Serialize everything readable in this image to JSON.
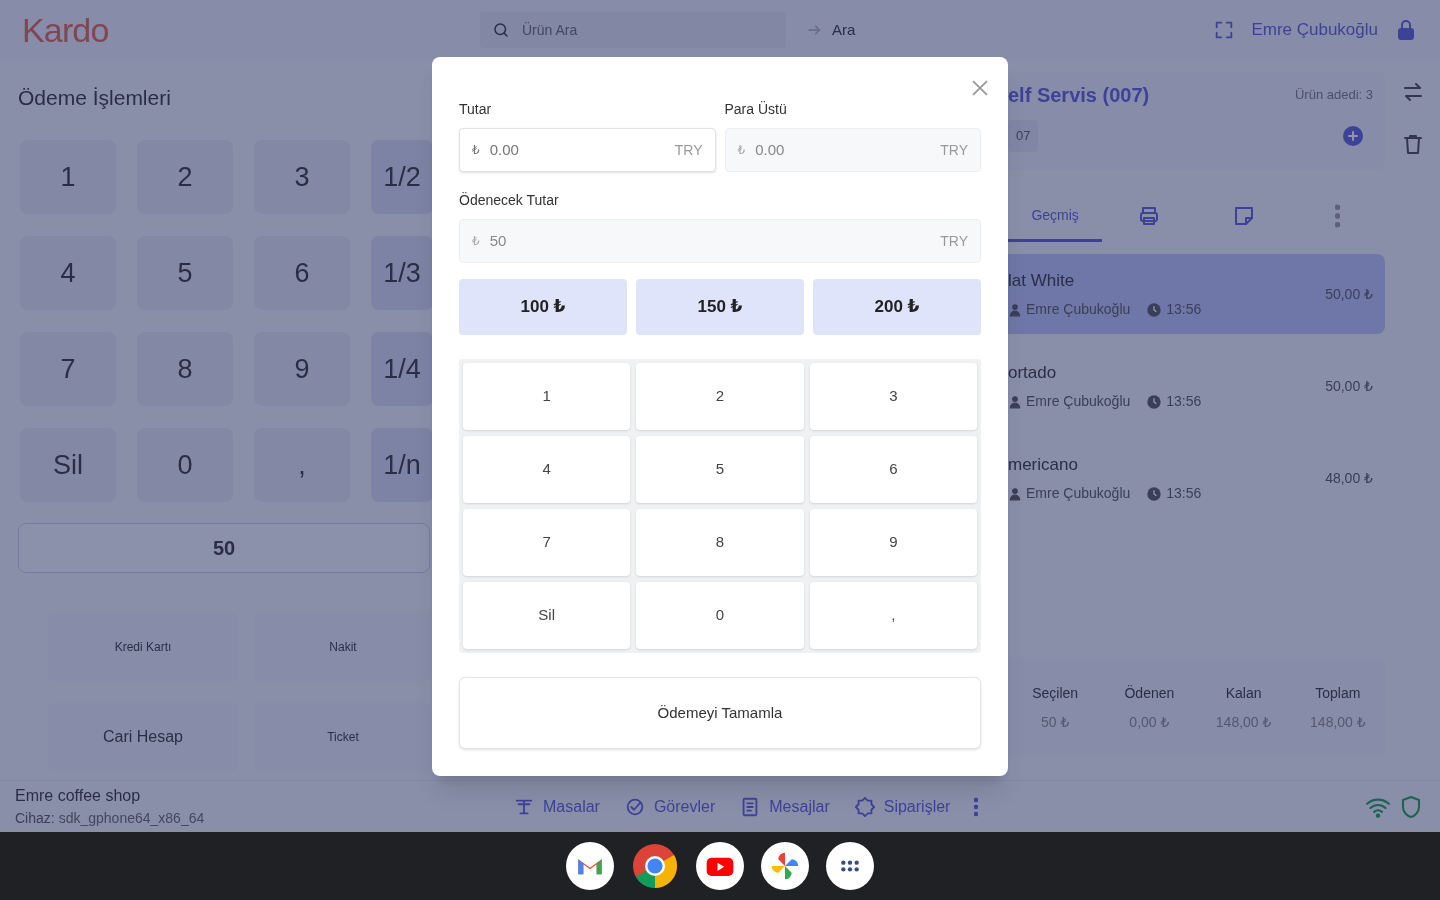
{
  "header": {
    "logo": "Kardo",
    "search_placeholder": "Ürün Ara",
    "search_button": "Ara",
    "user": "Emre Çubukoğlu"
  },
  "payment_panel": {
    "title": "Ödeme İşlemleri",
    "keys": [
      "1",
      "2",
      "3",
      "1/2",
      "4",
      "5",
      "6",
      "1/3",
      "7",
      "8",
      "9",
      "1/4",
      "Sil",
      "0",
      ",",
      "1/n"
    ],
    "amount": "50",
    "methods": [
      "Kredi Kartı",
      "Nakit",
      "Cari Hesap",
      "Ticket"
    ]
  },
  "order_panel": {
    "title": "elf Servis (007)",
    "count": "Ürün adedi: 3",
    "tag": "07",
    "tabs": [
      {
        "kind": "history",
        "label": "Geçmiş",
        "selected": true
      },
      {
        "kind": "print",
        "selected": false
      },
      {
        "kind": "note",
        "selected": false
      },
      {
        "kind": "more",
        "selected": false
      }
    ],
    "items": [
      {
        "name": "lat White",
        "user": "Emre Çubukoğlu",
        "time": "13:56",
        "price": "50,00 ₺",
        "selected": true
      },
      {
        "name": "ortado",
        "user": "Emre Çubukoğlu",
        "time": "13:56",
        "price": "50,00 ₺",
        "selected": false
      },
      {
        "name": "mericano",
        "user": "Emre Çubukoğlu",
        "time": "13:56",
        "price": "48,00 ₺",
        "selected": false
      }
    ],
    "summary": [
      {
        "label": "Seçilen",
        "value": "50 ₺"
      },
      {
        "label": "Ödenen",
        "value": "0,00 ₺"
      },
      {
        "label": "Kalan",
        "value": "148,00 ₺"
      },
      {
        "label": "Toplam",
        "value": "148,00 ₺"
      }
    ]
  },
  "footer": {
    "shop": "Emre coffee shop",
    "device_label": "Cihaz:",
    "device": "sdk_gphone64_x86_64",
    "nav": [
      {
        "kind": "tables",
        "label": "Masalar"
      },
      {
        "kind": "tasks",
        "label": "Görevler"
      },
      {
        "kind": "messages",
        "label": "Mesajlar"
      },
      {
        "kind": "orders",
        "label": "Siparişler"
      }
    ]
  },
  "modal": {
    "fields": [
      {
        "label": "Tutar",
        "placeholder": "0.00",
        "symbol": "₺",
        "unit": "TRY",
        "disabled": false
      },
      {
        "label": "Para Üstü",
        "value": "0.00",
        "symbol": "₺",
        "unit": "TRY",
        "disabled": true
      }
    ],
    "due": {
      "label": "Ödenecek Tutar",
      "value": "50",
      "symbol": "₺",
      "unit": "TRY",
      "disabled": true
    },
    "quick_amounts": [
      "100 ₺",
      "150 ₺",
      "200 ₺"
    ],
    "keys": [
      "1",
      "2",
      "3",
      "4",
      "5",
      "6",
      "7",
      "8",
      "9",
      "Sil",
      "0",
      ","
    ],
    "submit": "Ödemeyi Tamamla"
  },
  "taskbar": [
    {
      "kind": "mail"
    },
    {
      "kind": "browser"
    },
    {
      "kind": "video"
    },
    {
      "kind": "photos"
    },
    {
      "kind": "apps"
    }
  ]
}
